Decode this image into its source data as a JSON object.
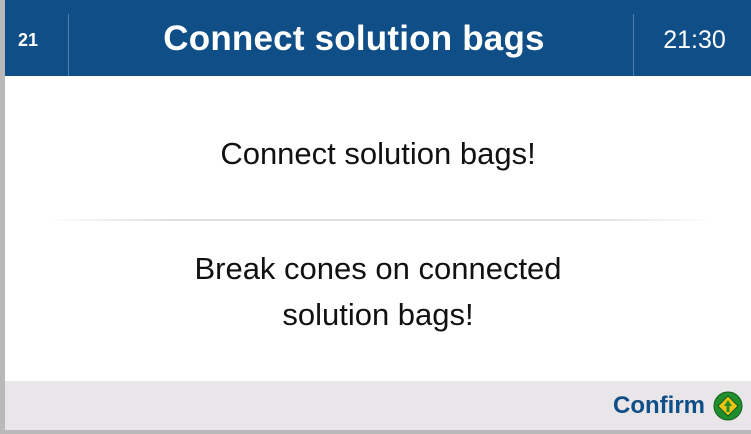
{
  "header": {
    "step_number": "21",
    "title": "Connect solution bags",
    "time": "21:30"
  },
  "body": {
    "message_primary": "Connect solution bags!",
    "message_secondary_line1": "Break cones on connected",
    "message_secondary_line2": "solution bags!"
  },
  "footer": {
    "confirm_label": "Confirm",
    "confirm_icon": "green-diamond-arrow-icon"
  },
  "colors": {
    "header_bg": "#0f4e86",
    "footer_bg": "#e9e6ea",
    "confirm_text": "#0f4e86",
    "confirm_icon": "#1f8f2e"
  }
}
